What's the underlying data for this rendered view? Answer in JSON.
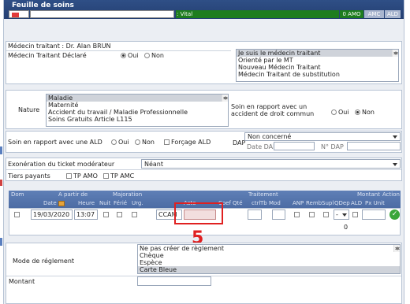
{
  "window": {
    "title": "Feuille de soins"
  },
  "header": {
    "vital_label": ": Vital",
    "amo_label": "0  AMO",
    "amc_label": "AMC",
    "ald_label": "ALD"
  },
  "medecin": {
    "traitant_line": "Médecin traitant : Dr. Alan BRUN",
    "declare_label": "Médecin Traitant Déclaré",
    "oui_label": "Oui",
    "non_label": "Non",
    "options": [
      "Je suis le médecin traitant",
      "Orienté par le MT",
      "Nouveau Médecin Traitant",
      "Médecin Traitant de substitution"
    ],
    "selected_index": 0
  },
  "nature": {
    "label": "Nature",
    "options": [
      "Maladie",
      "Maternité",
      "Accident du travail / Maladie Professionnelle",
      "Soins Gratuits Article L115"
    ],
    "selected_index": 0,
    "accident_label": "Soin en rapport avec un accident de droit commun",
    "oui_label": "Oui",
    "non_label": "Non"
  },
  "ald": {
    "label": "Soin en rapport avec une ALD",
    "oui_label": "Oui",
    "non_label": "Non",
    "forcage_label": "Forçage ALD",
    "dap_label": "DAP",
    "dap_value": "Non concerné",
    "date_dap_label": "Date DAP",
    "no_dap_label": "N° DAP"
  },
  "ticket": {
    "exo_label": "Exonération du ticket modérateur",
    "exo_value": "Néant",
    "tiers_label": "Tiers payants",
    "tp_amo_label": "TP AMO",
    "tp_amc_label": "TP AMC"
  },
  "table": {
    "headers": {
      "dom": "Dom",
      "a_partir_de": "A partir de",
      "majoration": "Majoration",
      "traitement": "Traitement",
      "montant": "Montant",
      "action": "Action",
      "date": "Date",
      "heure": "Heure",
      "nuit": "Nuit",
      "ferie": "Férié",
      "urg": "Urg.",
      "acte": "Acte",
      "coef": "Coef",
      "qte": "Qté",
      "ctrl": "ctrl",
      "tb": "Tb",
      "mod": "Mod",
      "anp": "ANP",
      "remb": "Remb",
      "supl": "Supl",
      "qdep": "QDep",
      "ald": "ALD",
      "px_unit": "Px Unit"
    },
    "row": {
      "date": "19/03/2020",
      "heure": "13:07",
      "acte_code": "CCAM",
      "qdep_value": "-",
      "total": "0"
    }
  },
  "annotation": {
    "number": "5"
  },
  "reglement": {
    "label": "Mode de réglement",
    "options": [
      "Ne pas créer de règlement",
      "Chèque",
      "Espèce",
      "Carte Bleue"
    ],
    "selected_index": 3,
    "montant_label": "Montant"
  }
}
